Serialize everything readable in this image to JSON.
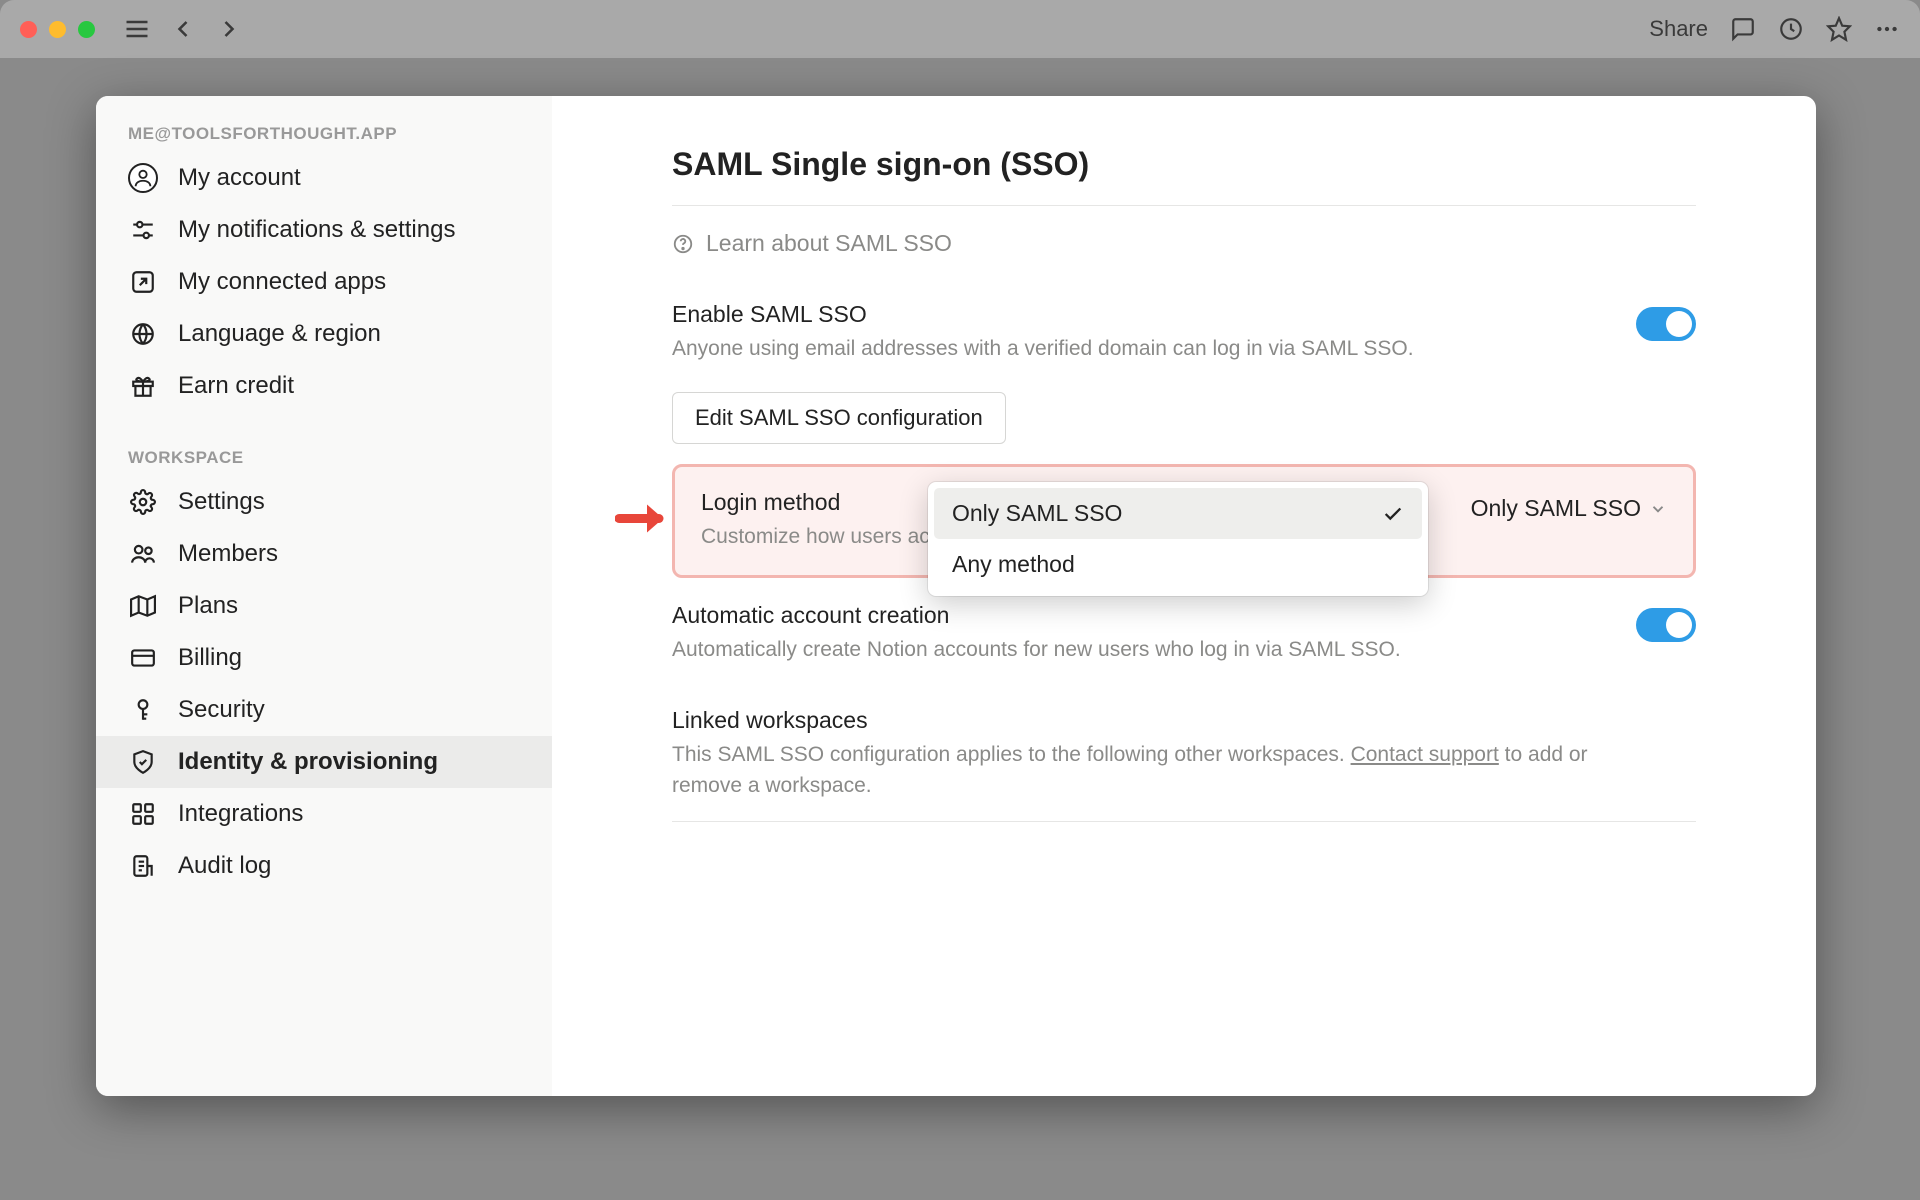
{
  "toolbar": {
    "share_label": "Share"
  },
  "sidebar": {
    "account_email_label": "ME@TOOLSFORTHOUGHT.APP",
    "account_items": [
      {
        "label": "My account",
        "icon": "avatar"
      },
      {
        "label": "My notifications & settings",
        "icon": "sliders"
      },
      {
        "label": "My connected apps",
        "icon": "arrow-up-right-box"
      },
      {
        "label": "Language & region",
        "icon": "globe"
      },
      {
        "label": "Earn credit",
        "icon": "gift"
      }
    ],
    "workspace_label": "WORKSPACE",
    "workspace_items": [
      {
        "label": "Settings",
        "icon": "gear"
      },
      {
        "label": "Members",
        "icon": "people"
      },
      {
        "label": "Plans",
        "icon": "map"
      },
      {
        "label": "Billing",
        "icon": "credit-card"
      },
      {
        "label": "Security",
        "icon": "key"
      },
      {
        "label": "Identity & provisioning",
        "icon": "shield-check",
        "active": true
      },
      {
        "label": "Integrations",
        "icon": "grid"
      },
      {
        "label": "Audit log",
        "icon": "audit"
      }
    ]
  },
  "main": {
    "title": "SAML Single sign-on (SSO)",
    "help_link": "Learn about SAML SSO",
    "enable": {
      "title": "Enable SAML SSO",
      "desc": "Anyone using email addresses with a verified domain can log in via SAML SSO."
    },
    "edit_config_button": "Edit SAML SSO configuration",
    "login_method": {
      "title": "Login method",
      "desc": "Customize how users access workspaces.",
      "selected": "Only SAML SSO",
      "options": [
        "Only SAML SSO",
        "Any method"
      ]
    },
    "auto_create": {
      "title": "Automatic account creation",
      "desc": "Automatically create Notion accounts for new users who log in via SAML SSO."
    },
    "linked": {
      "title": "Linked workspaces",
      "desc_1": "This SAML SSO configuration applies to the following other workspaces. ",
      "contact_support": "Contact support",
      "desc_2": " to add or remove a workspace."
    }
  }
}
